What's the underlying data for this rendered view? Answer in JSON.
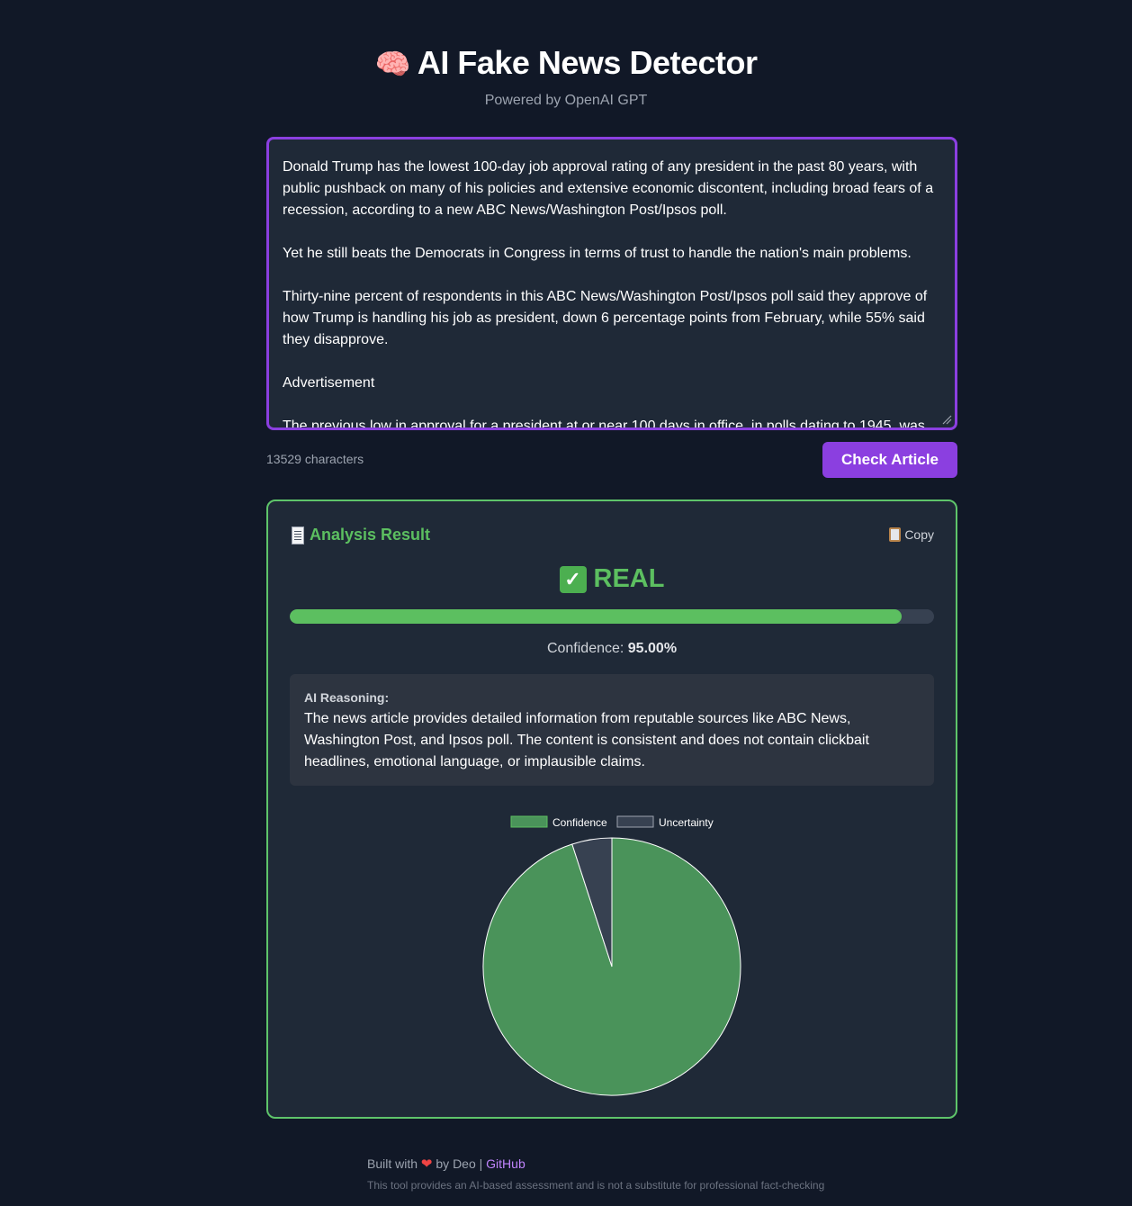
{
  "header": {
    "title": "AI Fake News Detector",
    "title_icon": "brain-icon",
    "subtitle": "Powered by OpenAI GPT"
  },
  "article": {
    "text": "Donald Trump has the lowest 100-day job approval rating of any president in the past 80 years, with public pushback on many of his policies and extensive economic discontent, including broad fears of a recession, according to a new ABC News/Washington Post/Ipsos poll.\n\nYet he still beats the Democrats in Congress in terms of trust to handle the nation's main problems.\n\nThirty-nine percent of respondents in this ABC News/Washington Post/Ipsos poll said they approve of how Trump is handling his job as president, down 6 percentage points from February, while 55% said they disapprove.\n\nAdvertisement\n\nThe previous low in approval for a president at or near 100 days in office, in polls dating to 1945, was",
    "char_count": "13529 characters"
  },
  "actions": {
    "check_label": "Check Article"
  },
  "result": {
    "header_label": "Analysis Result",
    "copy_label": "Copy",
    "verdict": "REAL",
    "confidence_label": "Confidence:",
    "confidence_value": "95.00%",
    "confidence_fraction": 0.95,
    "reasoning_label": "AI Reasoning:",
    "reasoning_text": "The news article provides detailed information from reputable sources like ABC News, Washington Post, and Ipsos poll. The content is consistent and does not contain clickbait headlines, emotional language, or implausible claims."
  },
  "colors": {
    "accent": "#8b3fe0",
    "success": "#5cbf60",
    "pie_confidence": "#4a935a",
    "pie_uncertainty": "#374151"
  },
  "chart_data": {
    "type": "pie",
    "categories": [
      "Confidence",
      "Uncertainty"
    ],
    "values": [
      95,
      5
    ],
    "colors": [
      "#4a935a",
      "#374151"
    ],
    "legend": "top"
  },
  "footer": {
    "built_with": "Built with",
    "by_text": "by Deo |",
    "github_label": "GitHub",
    "disclaimer": "This tool provides an AI-based assessment and is not a substitute for professional fact-checking"
  }
}
